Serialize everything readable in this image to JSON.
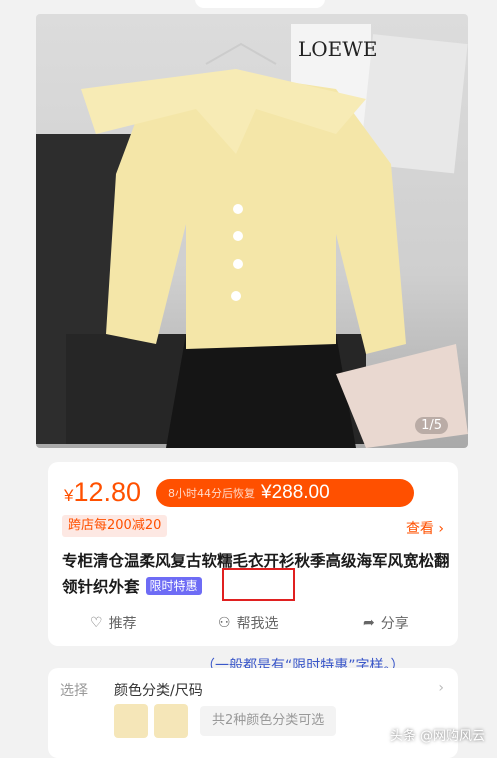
{
  "hero": {
    "brand_text": "LOEWE",
    "counter": "1/5"
  },
  "price": {
    "symbol": "¥",
    "current": "12.80",
    "restore_text": "8小时44分后恢复",
    "restore_price": "¥288.00",
    "promo": "跨店每200减20",
    "view_label": "查看"
  },
  "product": {
    "title": "专柜清仓温柔风复古软糯毛衣开衫秋季高级海军风宽松翻领针织外套",
    "tag": "限时特惠"
  },
  "actions": {
    "recommend": "推荐",
    "help_choose": "帮我选",
    "share": "分享"
  },
  "note": "（一般都是有“限时特惠”字样。）",
  "select": {
    "label": "选择",
    "value": "颜色分类/尺码",
    "available": "共2种颜色分类可选"
  },
  "watermark": "头条 @网购风云",
  "colors": {
    "accent": "#ff5000",
    "tag": "#6e6cf5",
    "highlight_box": "#e02020",
    "note": "#3a57c9"
  }
}
